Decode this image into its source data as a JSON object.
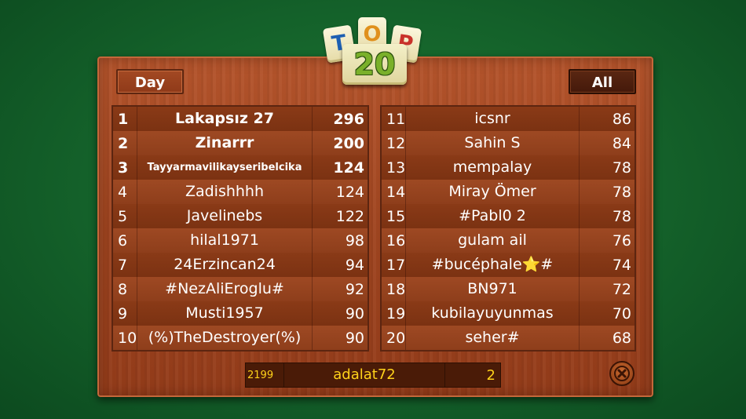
{
  "logo": {
    "letters": [
      "T",
      "O",
      "P"
    ],
    "number": "20"
  },
  "buttons": {
    "day_label": "Day",
    "all_label": "All"
  },
  "leaderboard_left": [
    {
      "rank": "1",
      "name": "Lakapsız 27",
      "score": "296"
    },
    {
      "rank": "2",
      "name": "Zinarrr",
      "score": "200"
    },
    {
      "rank": "3",
      "name": "Tayyarmavilikayseribelcika",
      "score": "124"
    },
    {
      "rank": "4",
      "name": "Zadishhhh",
      "score": "124"
    },
    {
      "rank": "5",
      "name": "Javelinebs",
      "score": "122"
    },
    {
      "rank": "6",
      "name": "hilal1971",
      "score": "98"
    },
    {
      "rank": "7",
      "name": "24Erzincan24",
      "score": "94"
    },
    {
      "rank": "8",
      "name": "#NezAliEroglu#",
      "score": "92"
    },
    {
      "rank": "9",
      "name": "Musti1957",
      "score": "90"
    },
    {
      "rank": "10",
      "name": "(%)TheDestroyer(%)",
      "score": "90"
    }
  ],
  "leaderboard_right": [
    {
      "rank": "11",
      "name": "icsnr",
      "score": "86"
    },
    {
      "rank": "12",
      "name": "Sahin S",
      "score": "84"
    },
    {
      "rank": "13",
      "name": "mempalay",
      "score": "78"
    },
    {
      "rank": "14",
      "name": "Miray Ömer",
      "score": "78"
    },
    {
      "rank": "15",
      "name": "#Pabl0 2",
      "score": "78"
    },
    {
      "rank": "16",
      "name": "gulam ail",
      "score": "76"
    },
    {
      "rank": "17",
      "name": "#bucéphale⭐#",
      "score": "74"
    },
    {
      "rank": "18",
      "name": "BN971",
      "score": "72"
    },
    {
      "rank": "19",
      "name": "kubilayuyunmas",
      "score": "70"
    },
    {
      "rank": "20",
      "name": "seher#",
      "score": "68"
    }
  ],
  "current_player": {
    "rank": "2199",
    "name": "adalat72",
    "score": "2"
  },
  "colors": {
    "felt": "#14612a",
    "wood": "#a04520",
    "player_text": "#ffd21a"
  },
  "icons": {
    "close": "close-icon"
  }
}
